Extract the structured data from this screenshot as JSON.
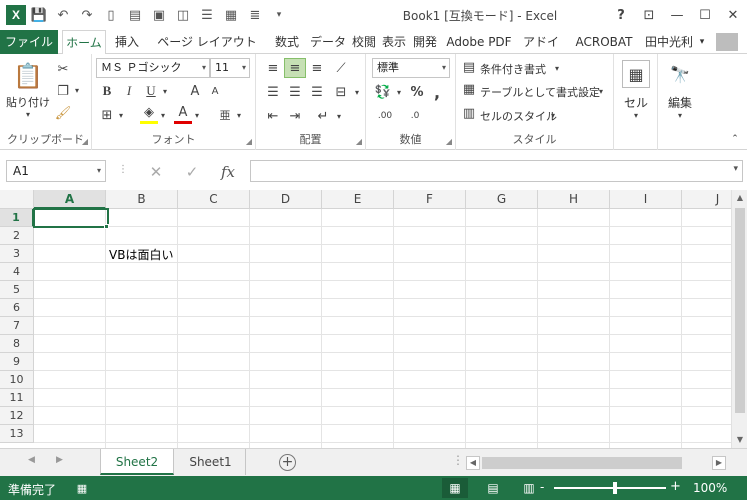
{
  "window": {
    "title": "Book1 [互換モード] - Excel",
    "help": "?",
    "app_badge": "X"
  },
  "tabs": {
    "file": "ファイル",
    "items": [
      "ホーム",
      "挿入",
      "ページ レイアウト",
      "数式",
      "データ",
      "校閲",
      "表示",
      "開発",
      "Adobe PDF",
      "アドイン",
      "ACROBAT"
    ],
    "active": "ホーム",
    "user": "田中光利"
  },
  "ribbon": {
    "clipboard": {
      "label": "クリップボード",
      "paste": "貼り付け"
    },
    "font": {
      "label": "フォント",
      "name": "ＭＳ Ｐゴシック",
      "size": "11",
      "bold": "B",
      "italic": "I",
      "underline": "U",
      "grow": "A",
      "shrink": "A",
      "font_color": "A",
      "phonetic": "亜"
    },
    "alignment": {
      "label": "配置"
    },
    "number": {
      "label": "数値",
      "format": "標準",
      "percent": "%",
      "comma": ",",
      "inc_decimal": ".00",
      "dec_decimal": ".0"
    },
    "styles": {
      "label": "スタイル",
      "conditional": "条件付き書式",
      "table": "テーブルとして書式設定",
      "cell_styles": "セルのスタイル"
    },
    "cells": {
      "label": "セル"
    },
    "editing": {
      "label": "編集"
    }
  },
  "formula_bar": {
    "name_box": "A1",
    "value": "",
    "fx": "fx"
  },
  "grid": {
    "columns": [
      "A",
      "B",
      "C",
      "D",
      "E",
      "F",
      "G",
      "H",
      "I",
      "J"
    ],
    "rows": [
      "1",
      "2",
      "3",
      "4",
      "5",
      "6",
      "7",
      "8",
      "9",
      "10",
      "11",
      "12",
      "13"
    ],
    "selected_cell": "A1",
    "cells": {
      "B3": "VBは面白い"
    }
  },
  "sheets": {
    "tabs": [
      "Sheet2",
      "Sheet1"
    ],
    "active": "Sheet2"
  },
  "status": {
    "ready": "準備完了",
    "zoom": "100%",
    "zoom_minus": "-",
    "zoom_plus": "+"
  }
}
